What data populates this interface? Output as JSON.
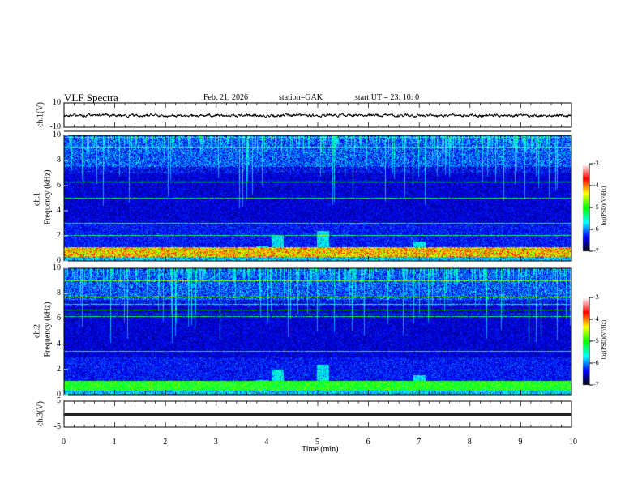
{
  "header": {
    "title": "VLF  Spectra",
    "date": "Feb. 21, 2026",
    "station": "station=GAK",
    "start_ut": "start  UT  =   23: 10: 0"
  },
  "chart_data": {
    "type": "heatmap",
    "xlabel": "Time  (min)",
    "xlim": [
      0,
      10
    ],
    "x_ticks": [
      "0",
      "1",
      "2",
      "3",
      "4",
      "5",
      "6",
      "7",
      "8",
      "9",
      "10"
    ],
    "panels": [
      {
        "id": "ch1-waveform",
        "type": "line",
        "ylabel": "ch.1(V)",
        "ylim": [
          -10,
          10
        ],
        "y_ticks": [
          "10",
          "-10"
        ]
      },
      {
        "id": "ch1-spectrogram",
        "type": "heatmap",
        "ylabel_top": "ch.1",
        "ylabel": "Frequency  (kHz)",
        "ylim": [
          0,
          10
        ],
        "y_ticks": [
          "0",
          "2",
          "4",
          "6",
          "8",
          "10"
        ],
        "colorbar": {
          "label": "log(PSD)(V²/Hz)",
          "range": [
            -7,
            -3
          ],
          "ticks": [
            "-3",
            "-4",
            "-5",
            "-6",
            "-7"
          ]
        }
      },
      {
        "id": "ch2-spectrogram",
        "type": "heatmap",
        "ylabel_top": "ch.2",
        "ylabel": "Frequency  (kHz)",
        "ylim": [
          0,
          10
        ],
        "y_ticks": [
          "0",
          "2",
          "4",
          "6",
          "8",
          "10"
        ],
        "colorbar": {
          "label": "log(PSD)(V²/Hz)",
          "range": [
            -7,
            -3
          ],
          "ticks": [
            "-3",
            "-4",
            "-5",
            "-6",
            "-7"
          ]
        }
      },
      {
        "id": "ch3-waveform",
        "type": "line",
        "ylabel": "ch.3(V)",
        "ylim": [
          -5,
          5
        ],
        "y_ticks": [
          "5",
          "-5"
        ],
        "approx_level": 0.3
      }
    ],
    "colormap": [
      "#000000",
      "#0000ff",
      "#00ffff",
      "#00ff00",
      "#ffff00",
      "#ff0000",
      "#ffffff"
    ]
  }
}
